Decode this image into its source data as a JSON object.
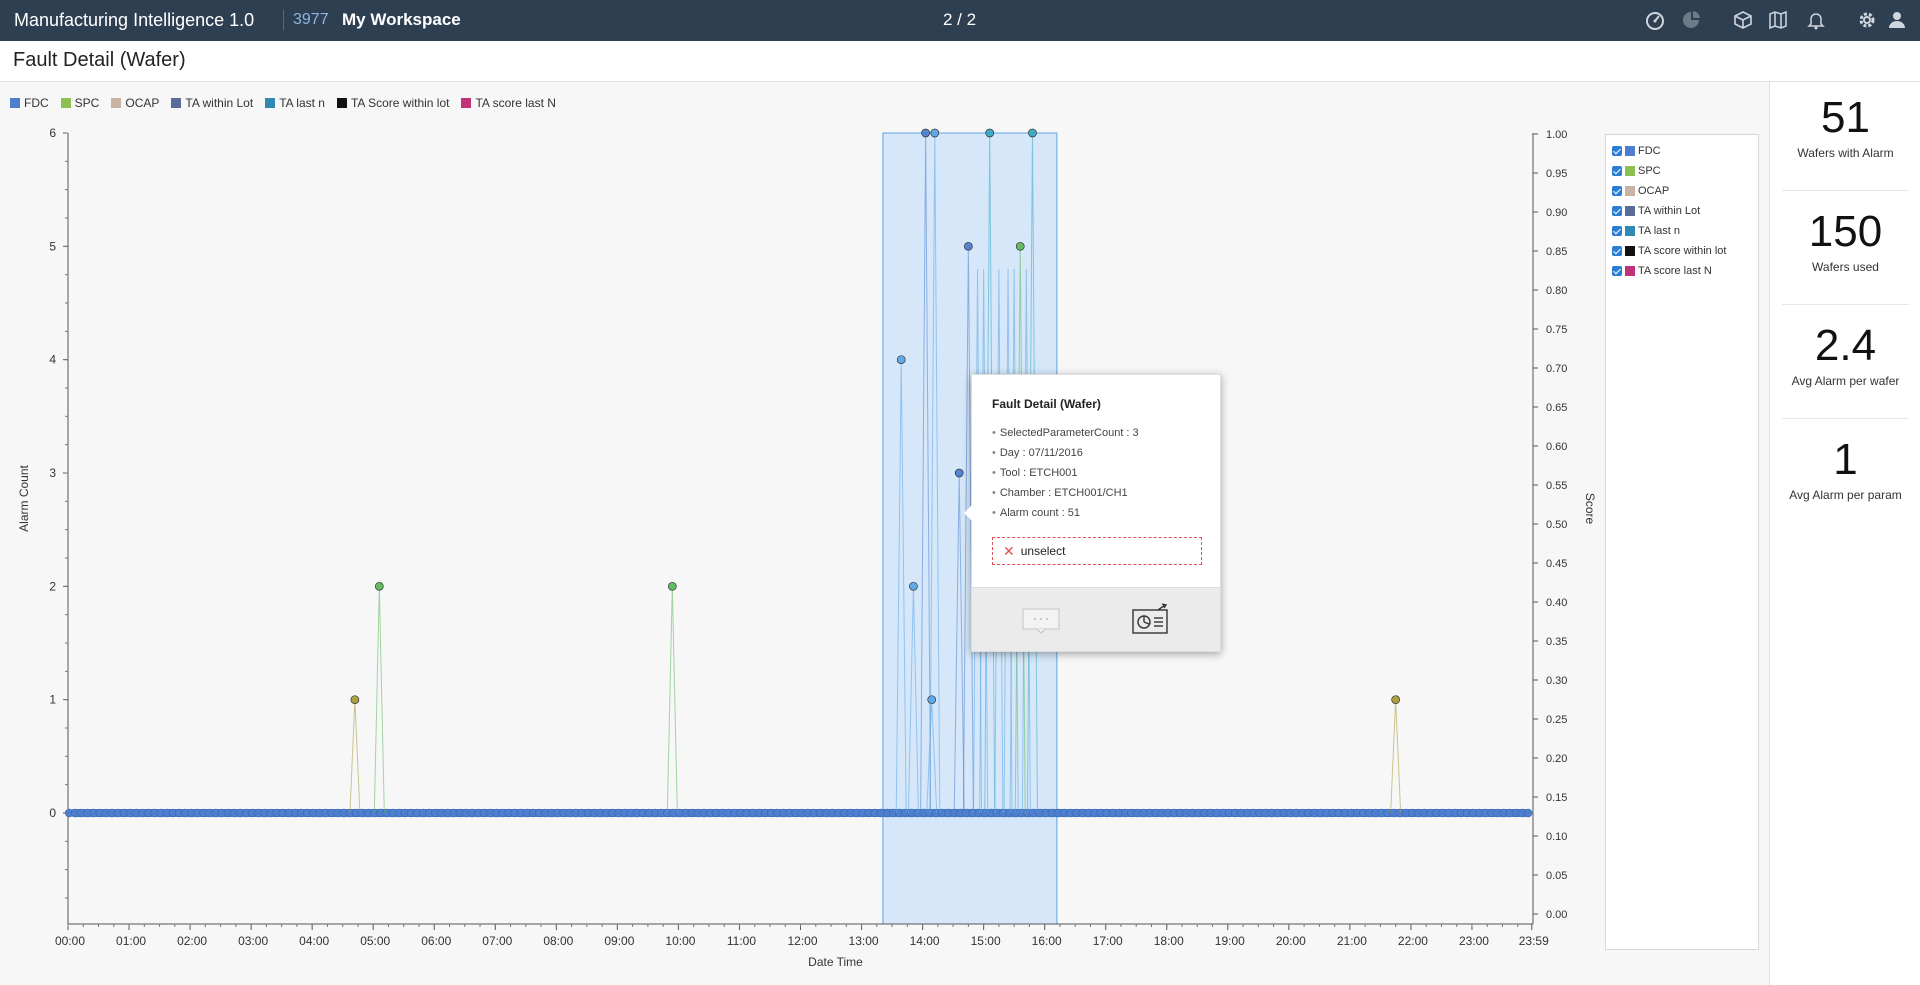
{
  "topbar": {
    "app_title": "Manufacturing Intelligence 1.0",
    "workspace_id": "3977",
    "workspace_name": "My Workspace",
    "pager": "2 / 2",
    "icons": [
      "dashboard-icon",
      "pie-chart-icon",
      "cube-icon",
      "map-icon",
      "bell-icon",
      "gear-icon",
      "user-icon"
    ]
  },
  "page": {
    "title": "Fault Detail (Wafer)"
  },
  "legend_top": [
    {
      "label": "FDC",
      "color": "#4e7fcf"
    },
    {
      "label": "SPC",
      "color": "#8cc152"
    },
    {
      "label": "OCAP",
      "color": "#c9b3a4"
    },
    {
      "label": "TA within Lot",
      "color": "#5b6b9a"
    },
    {
      "label": "TA last n",
      "color": "#2f8ab3"
    },
    {
      "label": "TA Score within lot",
      "color": "#111111"
    },
    {
      "label": "TA score last N",
      "color": "#c0337a"
    }
  ],
  "legend_right": [
    {
      "label": "FDC",
      "color": "#4e7fcf"
    },
    {
      "label": "SPC",
      "color": "#8cc152"
    },
    {
      "label": "OCAP",
      "color": "#c9b3a4"
    },
    {
      "label": "TA within Lot",
      "color": "#5b6b9a"
    },
    {
      "label": "TA last n",
      "color": "#2f8ab3"
    },
    {
      "label": "TA score within lot",
      "color": "#111111"
    },
    {
      "label": "TA score last N",
      "color": "#c0337a"
    }
  ],
  "kpis": [
    {
      "value": "51",
      "label": "Wafers with Alarm"
    },
    {
      "value": "150",
      "label": "Wafers used"
    },
    {
      "value": "2.4",
      "label": "Avg Alarm per wafer"
    },
    {
      "value": "1",
      "label": "Avg Alarm per param"
    }
  ],
  "tooltip": {
    "title": "Fault Detail (Wafer)",
    "rows": [
      "SelectedParameterCount : 3",
      "Day : 07/11/2016",
      "Tool : ETCH001",
      "Chamber : ETCH001/CH1",
      "Alarm count : 51"
    ],
    "unselect_label": "unselect"
  },
  "chart_data": {
    "type": "scatter",
    "title": "",
    "xlabel": "Date Time",
    "ylabel": "Alarm Count",
    "y2label": "Score",
    "x_ticks": [
      "00:00",
      "01:00",
      "02:00",
      "03:00",
      "04:00",
      "05:00",
      "06:00",
      "07:00",
      "08:00",
      "09:00",
      "10:00",
      "11:00",
      "12:00",
      "13:00",
      "14:00",
      "15:00",
      "16:00",
      "17:00",
      "18:00",
      "19:00",
      "20:00",
      "21:00",
      "22:00",
      "23:00",
      "23:59"
    ],
    "y_ticks": [
      "0",
      "1",
      "2",
      "3",
      "4",
      "5",
      "6"
    ],
    "y2_ticks": [
      "0.00",
      "0.05",
      "0.10",
      "0.15",
      "0.20",
      "0.25",
      "0.30",
      "0.35",
      "0.40",
      "0.45",
      "0.50",
      "0.55",
      "0.60",
      "0.65",
      "0.70",
      "0.75",
      "0.80",
      "0.85",
      "0.90",
      "0.95",
      "1.00"
    ],
    "ylim": [
      0,
      6
    ],
    "y2lim": [
      0,
      1
    ],
    "xlim_hours": [
      0,
      24
    ],
    "selection_hours": [
      13.35,
      16.2
    ],
    "series": [
      {
        "name": "FDC",
        "color": "#4e7fcf",
        "points": [
          [
            14.05,
            6
          ],
          [
            14.75,
            5
          ],
          [
            14.6,
            3
          ]
        ]
      },
      {
        "name": "SPC",
        "color": "#5cb85c",
        "points": [
          [
            5.1,
            2
          ],
          [
            9.9,
            2
          ],
          [
            15.6,
            5
          ]
        ]
      },
      {
        "name": "OCAP",
        "color": "#a89a3a",
        "points": [
          [
            4.7,
            1
          ],
          [
            21.75,
            1
          ]
        ]
      },
      {
        "name": "TA last n",
        "color": "#3aa8c4",
        "points": [
          [
            15.1,
            6
          ],
          [
            15.8,
            6
          ]
        ]
      },
      {
        "name": "TA within Lot",
        "color": "#5ba6e6",
        "points": [
          [
            13.65,
            4
          ],
          [
            13.85,
            2
          ],
          [
            14.15,
            1
          ],
          [
            14.2,
            6
          ]
        ]
      }
    ]
  }
}
